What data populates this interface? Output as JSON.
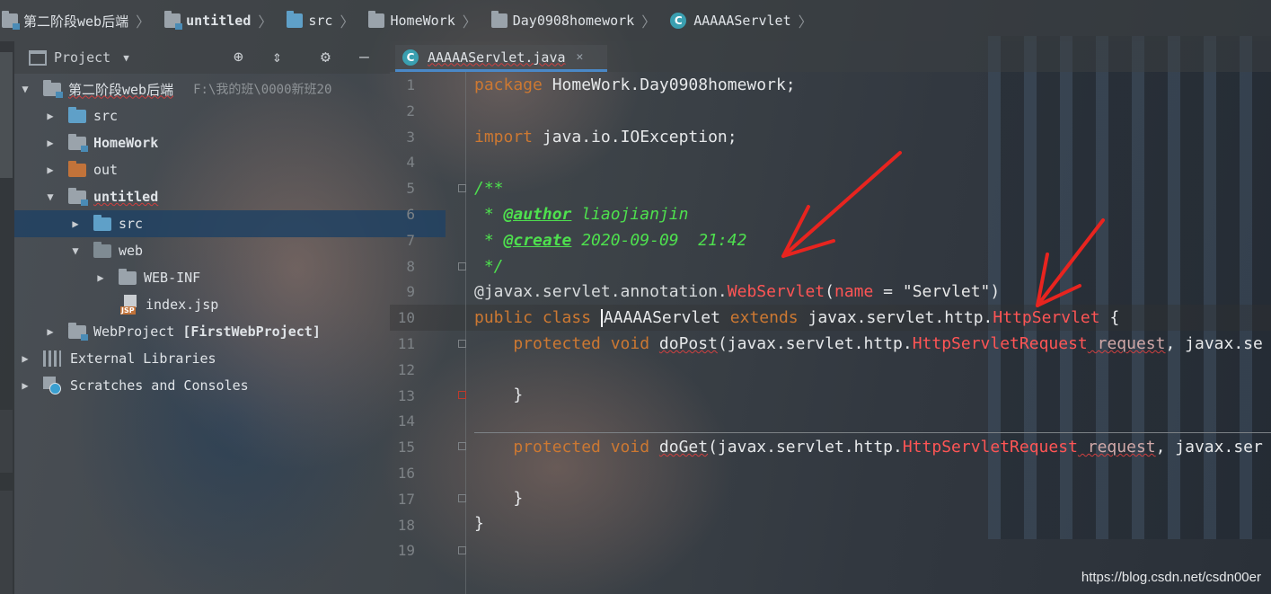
{
  "breadcrumb": [
    {
      "label": "第二阶段web后端",
      "icon": "module-icon",
      "bold": false
    },
    {
      "label": "untitled",
      "icon": "module-icon",
      "bold": true
    },
    {
      "label": "src",
      "icon": "source-folder-icon",
      "bold": false
    },
    {
      "label": "HomeWork",
      "icon": "package-icon",
      "bold": false
    },
    {
      "label": "Day0908homework",
      "icon": "package-icon",
      "bold": false
    },
    {
      "label": "AAAAAServlet",
      "icon": "class-icon",
      "bold": false
    }
  ],
  "project_panel": {
    "title": "Project",
    "tree": [
      {
        "label": "第二阶段web后端",
        "hint": "F:\\我的班\\0000新班20",
        "expanded": true,
        "icon": "module-folder-icon"
      },
      {
        "label": "src",
        "icon": "source-folder-icon"
      },
      {
        "label": "HomeWork",
        "icon": "module-folder-icon"
      },
      {
        "label": "out",
        "icon": "excluded-folder-icon"
      },
      {
        "label": "untitled",
        "icon": "module-folder-icon",
        "expanded": true
      },
      {
        "label": "src",
        "icon": "source-folder-icon",
        "selected": true
      },
      {
        "label": "web",
        "icon": "web-folder-icon",
        "expanded": true
      },
      {
        "label": "WEB-INF",
        "icon": "folder-icon"
      },
      {
        "label": "index.jsp",
        "icon": "jsp-file-icon"
      },
      {
        "label": "WebProject",
        "suffix": "[FirstWebProject]",
        "icon": "module-folder-icon"
      },
      {
        "label": "External Libraries",
        "icon": "library-icon"
      },
      {
        "label": "Scratches and Consoles",
        "icon": "scratches-icon"
      }
    ]
  },
  "editor": {
    "tab_label": "AAAAAServlet.java",
    "line_numbers": [
      "1",
      "2",
      "3",
      "4",
      "5",
      "6",
      "7",
      "8",
      "9",
      "10",
      "11",
      "12",
      "13",
      "14",
      "15",
      "16",
      "17",
      "18",
      "19"
    ],
    "code": {
      "l1_kw": "package",
      "l1_rest": " HomeWork.Day0908homework;",
      "l3_kw": "import",
      "l3_rest": " java.io.IOException;",
      "l5": "/**",
      "l6_star": " * ",
      "l6_tag": "@author",
      "l6_val": " liaojianjin",
      "l7_star": " * ",
      "l7_tag": "@create",
      "l7_val": " 2020-09-09  21:42",
      "l8": " */",
      "l9_a": "@javax.servlet.annotation.",
      "l9_b": "WebServlet",
      "l9_c": "(",
      "l9_d": "name",
      "l9_e": " = ",
      "l9_f": "\"Servlet\"",
      "l9_g": ")",
      "l10_kw": "public class ",
      "l10_name": "AAAAAServlet ",
      "l10_kw2": "extends",
      "l10_pkg": " javax.servlet.http.",
      "l10_red": "HttpServlet",
      "l10_end": " {",
      "l11_kw": "    protected void ",
      "l11_name": "doPost",
      "l11_a": "(javax.servlet.http.",
      "l11_red": "HttpServletRequest",
      "l11_param": " request",
      "l11_b": ", javax.se",
      "l13": "    }",
      "l15_kw": "    protected void ",
      "l15_name": "doGet",
      "l15_a": "(javax.servlet.http.",
      "l15_red": "HttpServletRequest",
      "l15_param": " request",
      "l15_b": ", javax.ser",
      "l17": "    }",
      "l18": "}"
    }
  },
  "watermark": "https://blog.csdn.net/csdn00er",
  "colors": {
    "keyword": "#cc7832",
    "doc_comment": "#4ee04e",
    "error_red": "#ff5555",
    "selection": "#214263",
    "annotation_arrow": "#e8241f"
  }
}
